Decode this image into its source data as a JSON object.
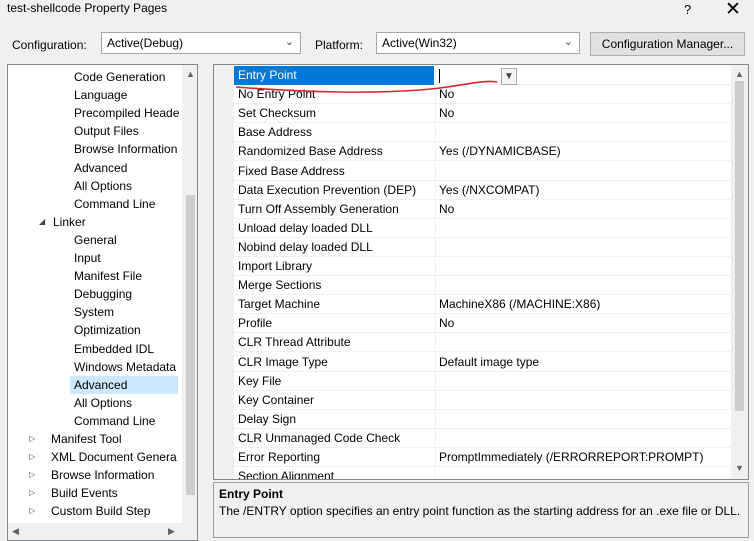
{
  "window": {
    "title": "test-shellcode Property Pages",
    "help_glyph": "?",
    "close_glyph": "✕"
  },
  "toolbar": {
    "configuration_label": "Configuration:",
    "configuration_value": "Active(Debug)",
    "platform_label": "Platform:",
    "platform_value": "Active(Win32)",
    "configuration_manager_label": "Configuration Manager..."
  },
  "tree": {
    "items": [
      {
        "label": "Code Generation"
      },
      {
        "label": "Language"
      },
      {
        "label": "Precompiled Heade"
      },
      {
        "label": "Output Files"
      },
      {
        "label": "Browse Information"
      },
      {
        "label": "Advanced"
      },
      {
        "label": "All Options"
      },
      {
        "label": "Command Line"
      },
      {
        "label": "Linker",
        "expander": "◢"
      },
      {
        "label": "General"
      },
      {
        "label": "Input"
      },
      {
        "label": "Manifest File"
      },
      {
        "label": "Debugging"
      },
      {
        "label": "System"
      },
      {
        "label": "Optimization"
      },
      {
        "label": "Embedded IDL"
      },
      {
        "label": "Windows Metadata"
      },
      {
        "label": "Advanced",
        "selected": true
      },
      {
        "label": "All Options"
      },
      {
        "label": "Command Line"
      },
      {
        "label": "Manifest Tool",
        "expander": "▷"
      },
      {
        "label": "XML Document Genera",
        "expander": "▷"
      },
      {
        "label": "Browse Information",
        "expander": "▷"
      },
      {
        "label": "Build Events",
        "expander": "▷"
      },
      {
        "label": "Custom Build Step",
        "expander": "▷"
      }
    ]
  },
  "properties": [
    {
      "name": "Entry Point",
      "value": "",
      "selected": true
    },
    {
      "name": "No Entry Point",
      "value": "No"
    },
    {
      "name": "Set Checksum",
      "value": "No"
    },
    {
      "name": "Base Address",
      "value": ""
    },
    {
      "name": "Randomized Base Address",
      "value": "Yes (/DYNAMICBASE)"
    },
    {
      "name": "Fixed Base Address",
      "value": ""
    },
    {
      "name": "Data Execution Prevention (DEP)",
      "value": "Yes (/NXCOMPAT)"
    },
    {
      "name": "Turn Off Assembly Generation",
      "value": "No"
    },
    {
      "name": "Unload delay loaded DLL",
      "value": ""
    },
    {
      "name": "Nobind delay loaded DLL",
      "value": ""
    },
    {
      "name": "Import Library",
      "value": ""
    },
    {
      "name": "Merge Sections",
      "value": ""
    },
    {
      "name": "Target Machine",
      "value": "MachineX86 (/MACHINE:X86)"
    },
    {
      "name": "Profile",
      "value": "No"
    },
    {
      "name": "CLR Thread Attribute",
      "value": ""
    },
    {
      "name": "CLR Image Type",
      "value": "Default image type"
    },
    {
      "name": "Key File",
      "value": ""
    },
    {
      "name": "Key Container",
      "value": ""
    },
    {
      "name": "Delay Sign",
      "value": ""
    },
    {
      "name": "CLR Unmanaged Code Check",
      "value": ""
    },
    {
      "name": "Error Reporting",
      "value": "PromptImmediately (/ERRORREPORT:PROMPT)"
    },
    {
      "name": "Section Alignment",
      "value": ""
    }
  ],
  "description": {
    "title": "Entry Point",
    "text": "The /ENTRY option specifies an entry point function as the starting address for an .exe file or DLL."
  },
  "colors": {
    "selection": "#0078d7",
    "tree_selection": "#cce8ff",
    "annotation": "#d9262b"
  }
}
